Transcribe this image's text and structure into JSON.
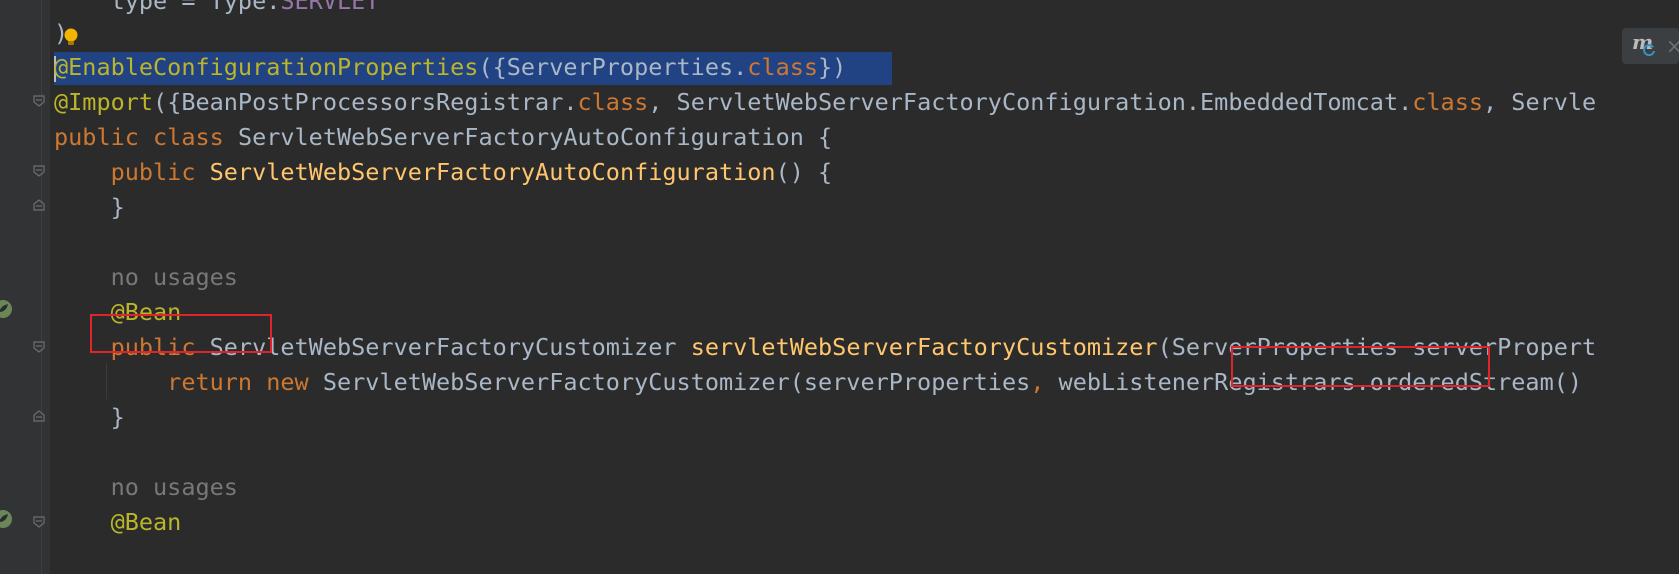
{
  "editor": {
    "lines": [
      {
        "segments": [
          {
            "t": "    type = Type.",
            "c": "plain"
          },
          {
            "t": "SERVLET",
            "c": "purple"
          }
        ]
      },
      {
        "segments": [
          {
            "t": ")",
            "c": "plain"
          }
        ]
      },
      {
        "segments": [
          {
            "t": "@EnableConfigurationProperties",
            "c": "ann"
          },
          {
            "t": "({ServerProperties.",
            "c": "plain"
          },
          {
            "t": "class",
            "c": "kw"
          },
          {
            "t": "})",
            "c": "plain"
          }
        ]
      },
      {
        "segments": [
          {
            "t": "@Import",
            "c": "ann"
          },
          {
            "t": "({BeanPostProcessorsRegistrar.",
            "c": "plain"
          },
          {
            "t": "class",
            "c": "kw"
          },
          {
            "t": ", ServletWebServerFactoryConfiguration.EmbeddedTomcat.",
            "c": "plain"
          },
          {
            "t": "class",
            "c": "kw"
          },
          {
            "t": ", Servle",
            "c": "plain"
          }
        ]
      },
      {
        "segments": [
          {
            "t": "public class ",
            "c": "kw"
          },
          {
            "t": "ServletWebServerFactoryAutoConfiguration {",
            "c": "plain"
          }
        ]
      },
      {
        "segments": [
          {
            "t": "    public ",
            "c": "kw"
          },
          {
            "t": "ServletWebServerFactoryAutoConfiguration",
            "c": "fn"
          },
          {
            "t": "() {",
            "c": "plain"
          }
        ]
      },
      {
        "segments": [
          {
            "t": "    }",
            "c": "plain"
          }
        ]
      },
      {
        "segments": []
      },
      {
        "segments": [
          {
            "t": "    no usages",
            "c": "inlay"
          }
        ]
      },
      {
        "segments": [
          {
            "t": "    @Bean",
            "c": "ann"
          }
        ]
      },
      {
        "segments": [
          {
            "t": "    public ",
            "c": "kw"
          },
          {
            "t": "ServletWebServerFactoryCustomizer ",
            "c": "plain"
          },
          {
            "t": "servletWebServerFactoryCustomizer",
            "c": "fn"
          },
          {
            "t": "(ServerProperties serverPropert",
            "c": "plain"
          }
        ]
      },
      {
        "segments": [
          {
            "t": "        return new ",
            "c": "kw"
          },
          {
            "t": "ServletWebServerFactoryCustomizer(serverProperties",
            "c": "plain"
          },
          {
            "t": ", ",
            "c": "kw"
          },
          {
            "t": "webListenerRegistrars.orderedStream()",
            "c": "plain"
          }
        ]
      },
      {
        "segments": [
          {
            "t": "    }",
            "c": "plain"
          }
        ]
      },
      {
        "segments": []
      },
      {
        "segments": [
          {
            "t": "    no usages",
            "c": "inlay"
          }
        ]
      },
      {
        "segments": [
          {
            "t": "    @Bean",
            "c": "ann"
          }
        ]
      }
    ]
  },
  "toolbar": {
    "maven_label": "m",
    "close_label": "×"
  },
  "colors": {
    "background": "#2b2b2b",
    "gutter": "#313335",
    "selection": "#214283",
    "keyword": "#cc7832",
    "annotation": "#bbb529",
    "method": "#ffc66d",
    "highlight_box": "#e0242b",
    "spring_bean": "#6a8759"
  }
}
